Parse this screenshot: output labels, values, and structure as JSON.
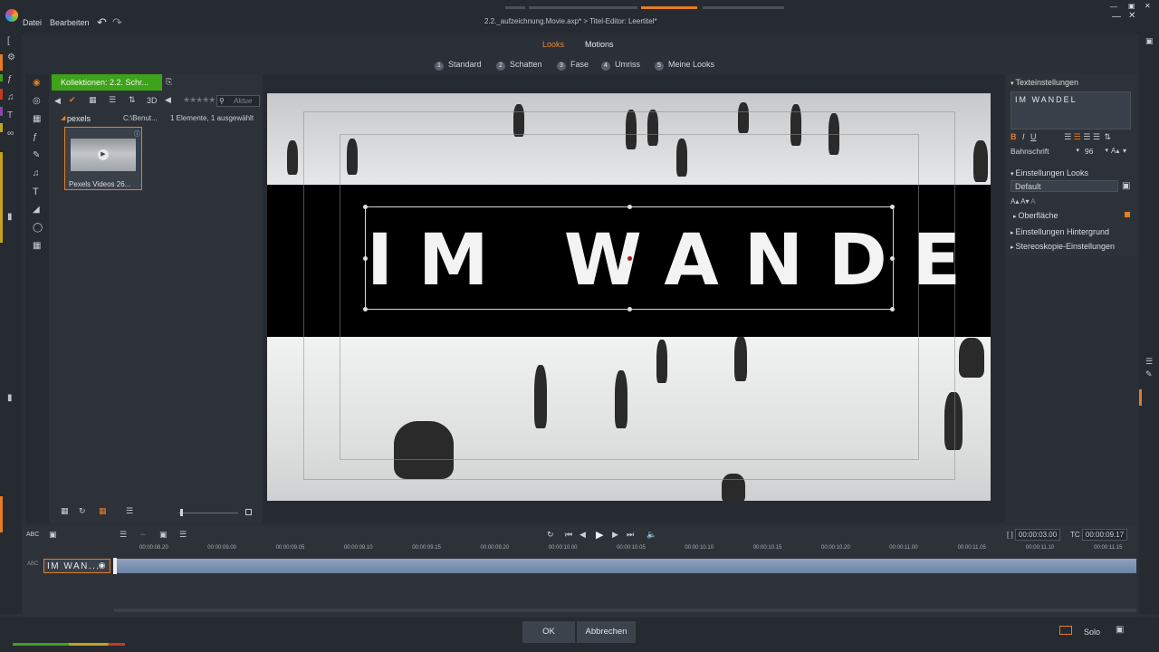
{
  "menu": {
    "file": "Datei",
    "edit": "Bearbeiten"
  },
  "document_title": "2.2._aufzeichnung.Movie.axp* > Titel-Editor: Leertitel*",
  "tabs": {
    "looks": "Looks",
    "motions": "Motions"
  },
  "look_subtabs": [
    {
      "num": "1",
      "label": "Standard"
    },
    {
      "num": "2",
      "label": "Schatten"
    },
    {
      "num": "3",
      "label": "Fase"
    },
    {
      "num": "4",
      "label": "Umriss"
    },
    {
      "num": "5",
      "label": "Meine Looks"
    }
  ],
  "library": {
    "collection_label": "Kollektionen: 2.2. Schr...",
    "view_3d": "3D",
    "search_placeholder": "Aktue",
    "folder_name": "pexels",
    "folder_path": "C:\\Benut...",
    "folder_status": "1 Elemente, 1 ausgewählt",
    "thumbnail_label": "Pexels Videos 26..."
  },
  "preview": {
    "title_text": "IM WANDEL"
  },
  "right_panel": {
    "text_settings_header": "Texteinstellungen",
    "text_value": "IM WANDEL",
    "font_name": "Bahnschrift",
    "font_size": "96",
    "looks_settings_header": "Einstellungen Looks",
    "looks_value": "Default",
    "surface_label": "Oberfläche",
    "background_header": "Einstellungen Hintergrund",
    "stereo_header": "Stereoskopie-Einstellungen"
  },
  "timeline": {
    "track_label": "IM WAN...",
    "duration_value": "00:00:03.00",
    "tc_label": "TC",
    "tc_value": "00:00:09.17",
    "ruler_ticks": [
      "00:00:08.20",
      "00:00:09.00",
      "00:00:09.05",
      "00:00:09.10",
      "00:00:09.15",
      "00:00:09.20",
      "00:00:10.00",
      "00:00:10.05",
      "00:00:10.10",
      "00:00:10.15",
      "00:00:10.20",
      "00:00:11.00",
      "00:00:11.05",
      "00:00:11.10",
      "00:00:11.15"
    ]
  },
  "footer": {
    "ok_label": "OK",
    "cancel_label": "Abbrechen",
    "solo_label": "Solo"
  },
  "colors": {
    "accent_orange": "#e47d24",
    "collection_green": "#3ea21b",
    "panel_dark": "#2b3038"
  }
}
